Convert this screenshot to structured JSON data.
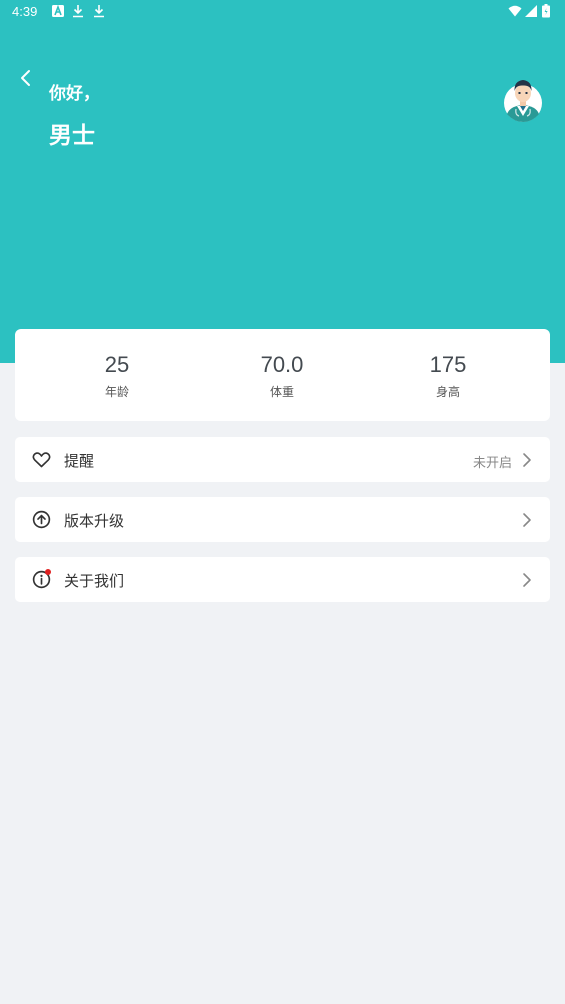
{
  "status_bar": {
    "time": "4:39",
    "icons": [
      "font-download-icon",
      "download-icon",
      "download-icon",
      "wifi-icon",
      "signal-icon",
      "battery-icon"
    ]
  },
  "header": {
    "greeting": "你好，",
    "username": "男士",
    "background_color": "#2cc1c1",
    "avatar": "doctor-avatar-icon"
  },
  "stats": [
    {
      "value": "25",
      "label": "年龄"
    },
    {
      "value": "70.0",
      "label": "体重"
    },
    {
      "value": "175",
      "label": "身高"
    }
  ],
  "menu": {
    "reminder": {
      "label": "提醒",
      "value": "未开启",
      "icon": "heart-icon"
    },
    "upgrade": {
      "label": "版本升级",
      "icon": "arrow-up-circle-icon"
    },
    "about": {
      "label": "关于我们",
      "icon": "info-icon",
      "badge_color": "#e02020"
    }
  }
}
